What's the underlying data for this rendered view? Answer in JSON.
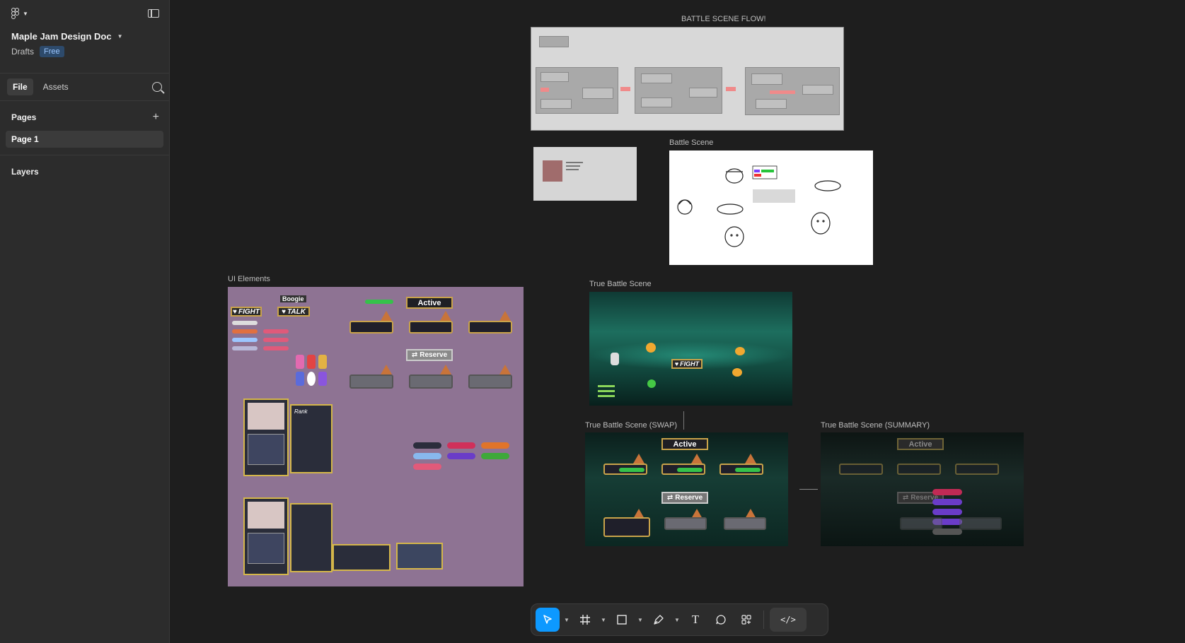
{
  "sidebar": {
    "doc_title": "Maple Jam Design Doc",
    "location": "Drafts",
    "plan_badge": "Free",
    "tabs": [
      {
        "label": "File"
      },
      {
        "label": "Assets"
      }
    ],
    "pages_header": "Pages",
    "pages": [
      {
        "label": "Page 1"
      }
    ],
    "layers_header": "Layers"
  },
  "canvas": {
    "frames": {
      "flow": "BATTLE SCENE FLOW!",
      "battle_scene": "Battle Scene",
      "ui_elements": "UI Elements",
      "true_battle": "True Battle Scene",
      "true_swap": "True Battle Scene (SWAP)",
      "true_summary": "True Battle Scene (SUMMARY)"
    },
    "game_text": {
      "fight": "FIGHT",
      "talk": "TALK",
      "active": "Active",
      "reserve": "Reserve",
      "boogie": "Boogie",
      "rank": "Rank"
    }
  },
  "toolbar": {
    "tools": [
      "move",
      "frame",
      "rectangle",
      "pen",
      "text",
      "comment",
      "actions",
      "dev-mode"
    ],
    "text_tool_glyph": "T",
    "dev_glyph": "</>"
  }
}
